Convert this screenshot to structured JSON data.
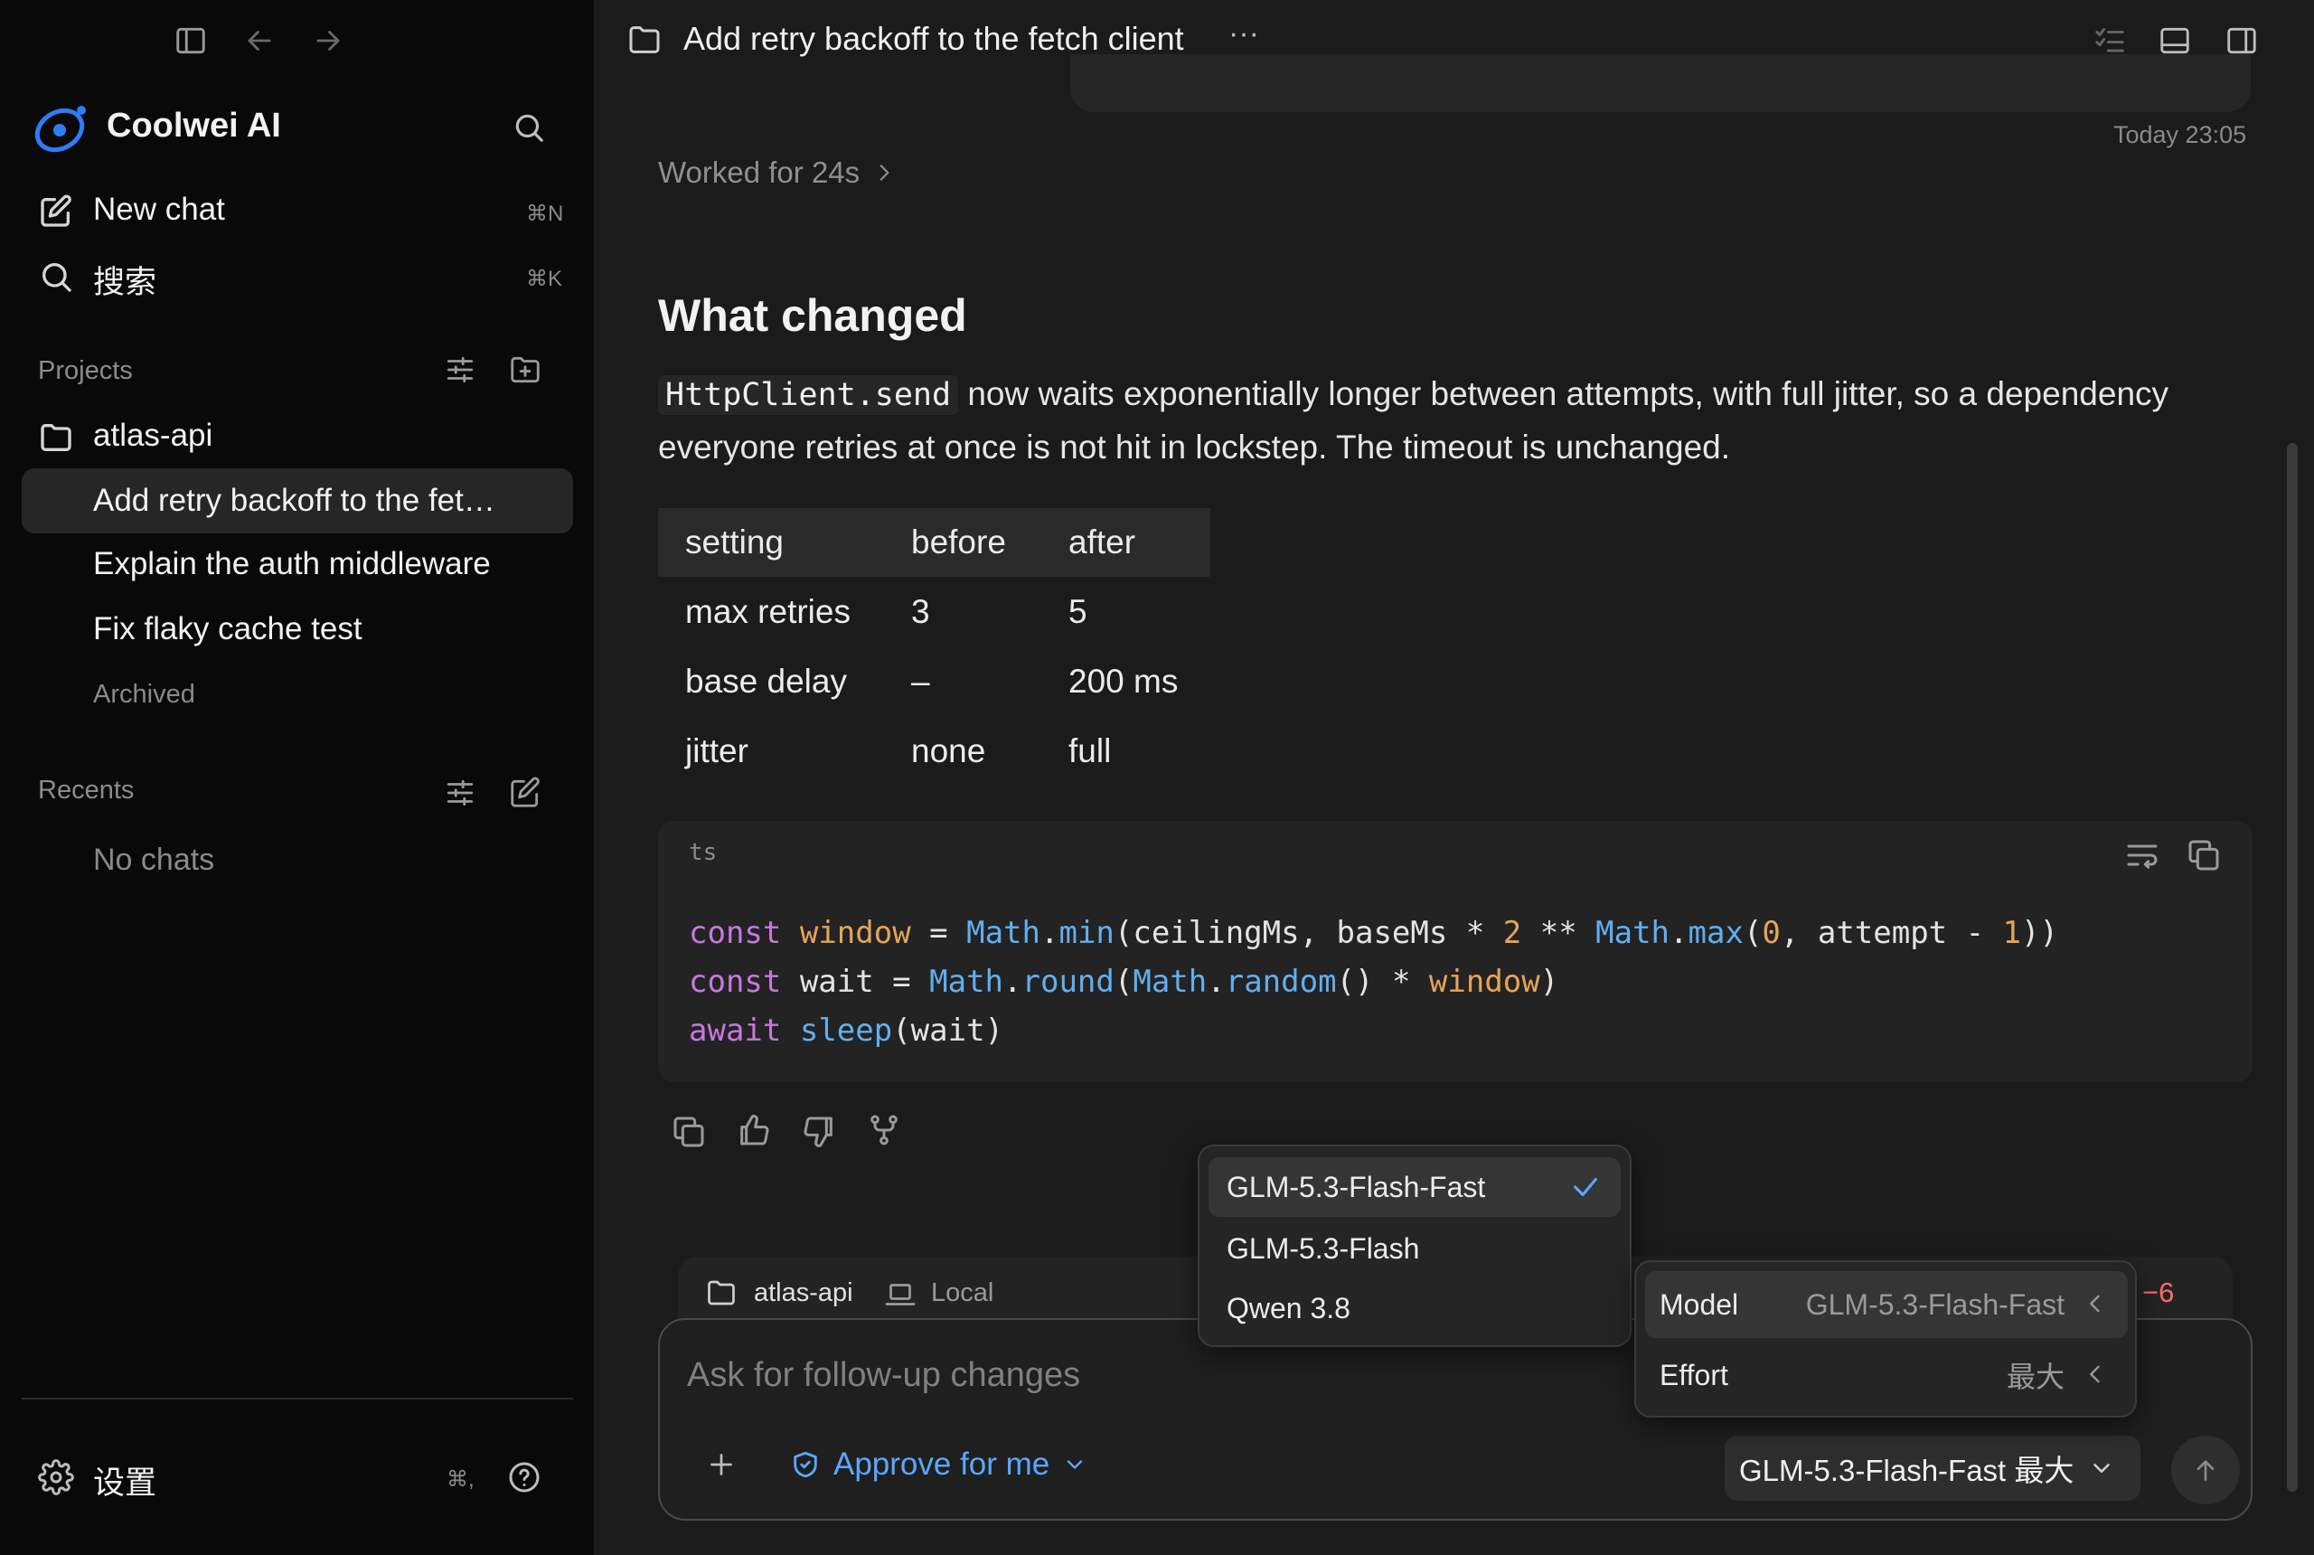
{
  "app": {
    "name": "Coolwei AI"
  },
  "sidebar": {
    "new_chat": {
      "label": "New chat",
      "shortcut": "⌘N"
    },
    "search": {
      "label": "搜索",
      "shortcut": "⌘K"
    },
    "projects": {
      "heading": "Projects",
      "project": "atlas-api",
      "items": [
        "Add retry backoff to the fet…",
        "Explain the auth middleware",
        "Fix flaky cache test"
      ],
      "archived": "Archived"
    },
    "recents": {
      "heading": "Recents",
      "empty": "No chats"
    },
    "settings": {
      "label": "设置",
      "shortcut": "⌘,"
    }
  },
  "topbar": {
    "title": "Add retry backoff to the fetch client",
    "more": "···"
  },
  "thread": {
    "timestamp": "Today 23:05",
    "worked": "Worked for 24s",
    "heading": "What changed",
    "para_code": "HttpClient.send",
    "para_text": " now waits exponentially longer between attempts, with full jitter, so a dependency everyone retries at once is not hit in lockstep. The timeout is unchanged.",
    "table": {
      "headers": [
        "setting",
        "before",
        "after"
      ],
      "rows": [
        [
          "max retries",
          "3",
          "5"
        ],
        [
          "base delay",
          "–",
          "200 ms"
        ],
        [
          "jitter",
          "none",
          "full"
        ]
      ]
    },
    "code": {
      "lang": "ts"
    }
  },
  "composer": {
    "project": "atlas-api",
    "location": "Local",
    "diff": "−6",
    "placeholder": "Ask for follow-up changes",
    "approve": "Approve for me",
    "model_button": "GLM-5.3-Flash-Fast 最大"
  },
  "model_menu": {
    "options": [
      "GLM-5.3-Flash-Fast",
      "GLM-5.3-Flash",
      "Qwen 3.8"
    ],
    "selected": "GLM-5.3-Flash-Fast"
  },
  "settings_menu": {
    "model_label": "Model",
    "model_value": "GLM-5.3-Flash-Fast",
    "effort_label": "Effort",
    "effort_value": "最大"
  },
  "colors": {
    "accent": "#5aa7ff",
    "diff_removed": "#ff6b6b"
  }
}
